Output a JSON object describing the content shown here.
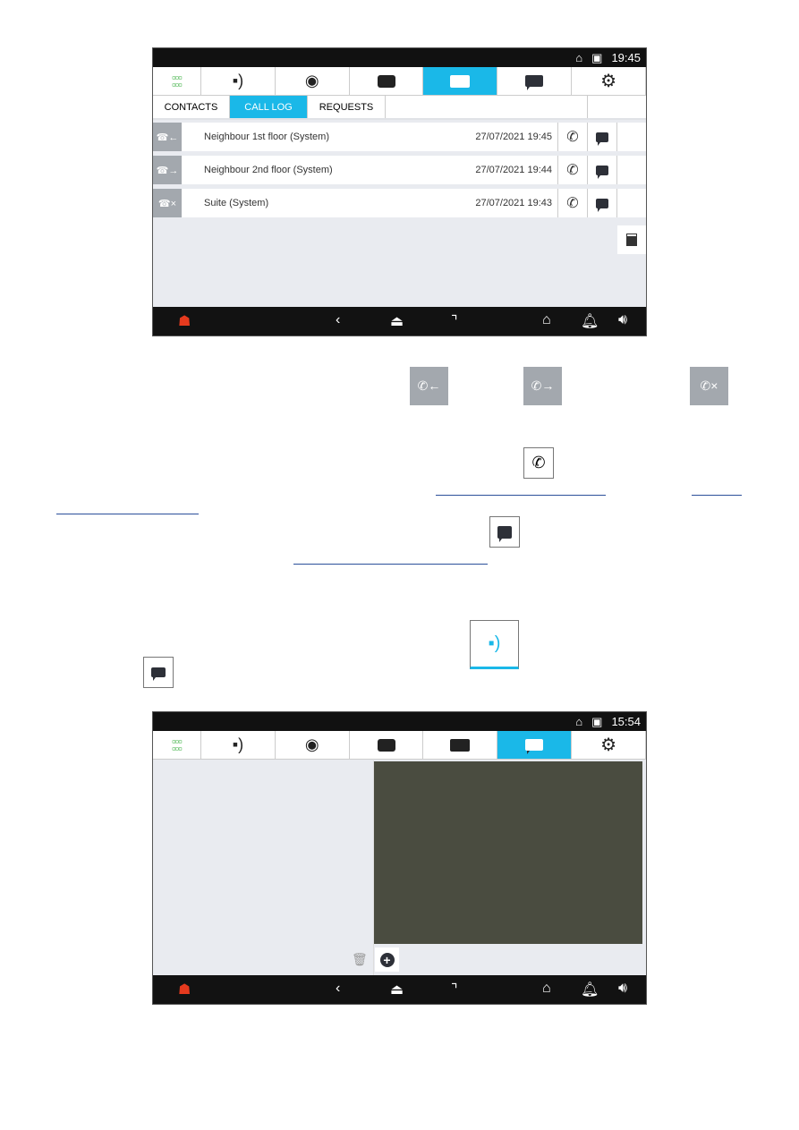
{
  "colors": {
    "accent": "#1ab8e8",
    "apps_green": "#3cb043",
    "alarm_red": "#e63a1e",
    "entry_grey": "#a3a8ae"
  },
  "screen1": {
    "time": "19:45",
    "nav_icons": [
      "apps-grid-icon",
      "intercom-call-icon",
      "eye-icon",
      "voicemail-icon",
      "contacts-card-icon",
      "chat-icon",
      "settings-icon"
    ],
    "active_nav": "contacts-card-icon",
    "tabs": [
      "CONTACTS",
      "CALL LOG",
      "REQUESTS"
    ],
    "active_tab": "CALL LOG",
    "calls": [
      {
        "type": "incoming",
        "icon": "☎←",
        "name": "Neighbour 1st floor (System)",
        "datetime": "27/07/2021 19:45"
      },
      {
        "type": "outgoing",
        "icon": "☎→",
        "name": "Neighbour 2nd floor (System)",
        "datetime": "27/07/2021 19:44"
      },
      {
        "type": "missed",
        "icon": "☎×",
        "name": "Suite (System)",
        "datetime": "27/07/2021 19:43"
      }
    ]
  },
  "legend_icons": [
    "incoming-call-icon",
    "outgoing-call-icon",
    "missed-call-icon",
    "call-back-icon",
    "message-icon",
    "intercom-tab-icon",
    "chat-tab-icon"
  ],
  "screen2": {
    "time": "15:54",
    "active_nav": "chat-icon"
  }
}
